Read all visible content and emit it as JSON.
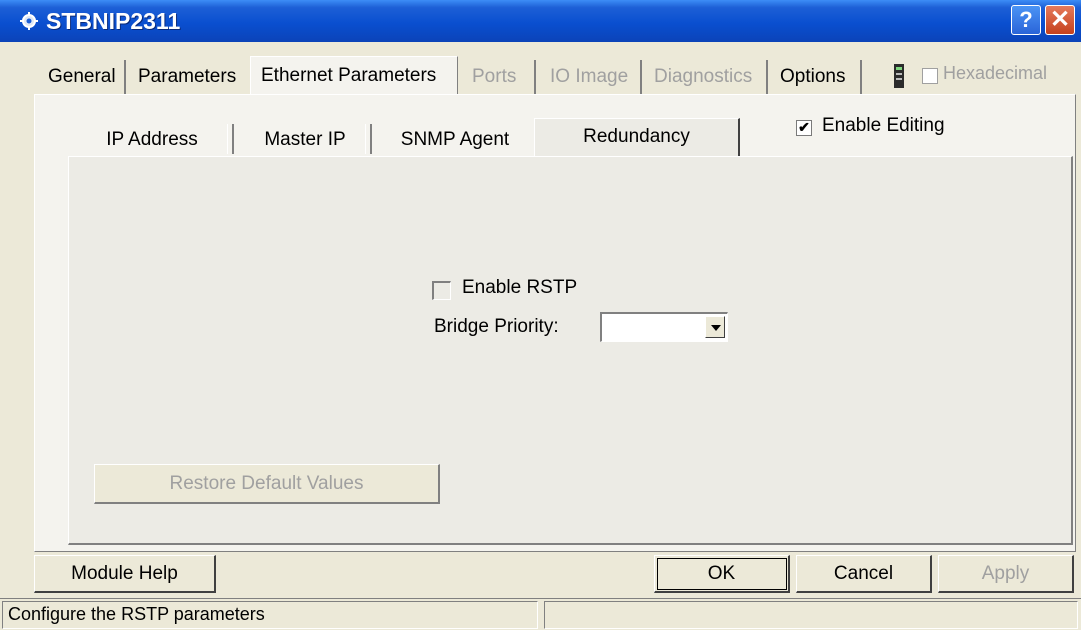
{
  "window": {
    "title": "STBNIP2311",
    "help_label": "?",
    "close_label": "✕"
  },
  "main_tabs": [
    {
      "label": "General",
      "state": "normal"
    },
    {
      "label": "Parameters",
      "state": "normal"
    },
    {
      "label": "Ethernet Parameters",
      "state": "selected"
    },
    {
      "label": "Ports",
      "state": "disabled"
    },
    {
      "label": "IO Image",
      "state": "disabled"
    },
    {
      "label": "Diagnostics",
      "state": "disabled"
    },
    {
      "label": "Options",
      "state": "normal"
    }
  ],
  "hexadecimal": {
    "label": "Hexadecimal",
    "checked": false,
    "enabled": false
  },
  "sub_tabs": [
    {
      "label": "IP Address",
      "state": "normal"
    },
    {
      "label": "Master IP",
      "state": "normal"
    },
    {
      "label": "SNMP Agent",
      "state": "normal"
    },
    {
      "label": "Redundancy",
      "state": "selected"
    }
  ],
  "enable_editing": {
    "label": "Enable Editing",
    "checked": true,
    "mark": "✔"
  },
  "redundancy": {
    "enable_rstp_label": "Enable RSTP",
    "enable_rstp_checked": false,
    "bridge_priority_label": "Bridge Priority:",
    "bridge_priority_value": ""
  },
  "restore_button": "Restore Default Values",
  "buttons": {
    "module_help": "Module Help",
    "ok": "OK",
    "cancel": "Cancel",
    "apply": "Apply"
  },
  "status_bar": {
    "text": "Configure the RSTP parameters"
  },
  "colors": {
    "title_bar": "#0a4fd0",
    "dialog_bg": "#ece9d8",
    "disabled_text": "#a0a0a0"
  }
}
